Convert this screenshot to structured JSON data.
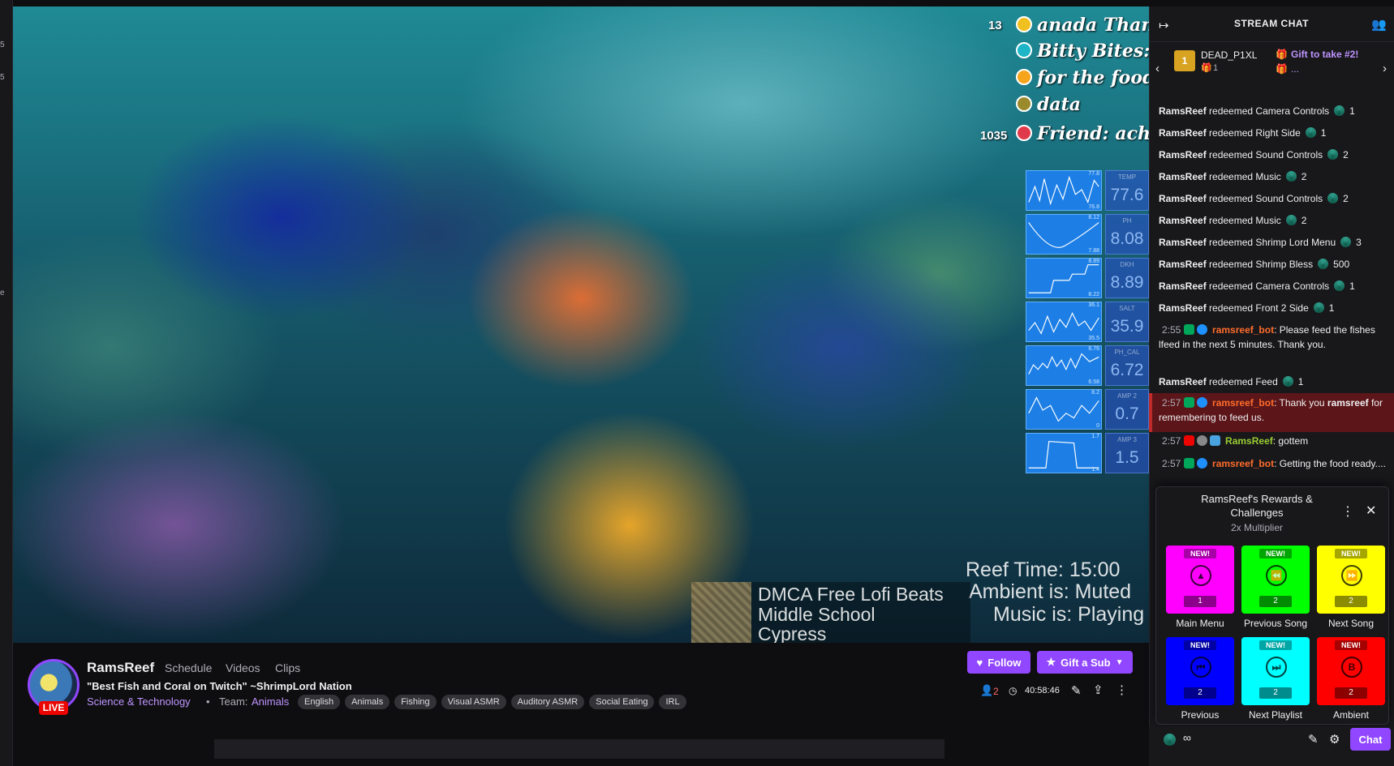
{
  "left_strip": {
    "texts": [
      "5",
      "5",
      "e"
    ]
  },
  "overlay": {
    "top_lines": [
      {
        "num": "13",
        "text": "anada Than"
      },
      {
        "num": "",
        "text": "Bitty Bites: c"
      },
      {
        "num": "",
        "text": "for the food"
      },
      {
        "num": "",
        "text": "data"
      },
      {
        "num": "1035",
        "text": "Friend: achozi"
      }
    ],
    "graphs": [
      {
        "label": "TEMP",
        "value": "77.6",
        "top_max": "77.8",
        "bottom_min": "76.8"
      },
      {
        "label": "PH",
        "value": "8.08",
        "top_max": "8.12",
        "bottom_min": "7.88"
      },
      {
        "label": "DKH",
        "value": "8.89",
        "top_max": "8.89",
        "bottom_min": "8.22"
      },
      {
        "label": "SALT",
        "value": "35.9",
        "top_max": "36.1",
        "bottom_min": "35.5"
      },
      {
        "label": "PH_CAL",
        "value": "6.72",
        "top_max": "6.76",
        "bottom_min": "6.58"
      },
      {
        "label": "AMP 2",
        "value": "0.7",
        "top_max": "8.2",
        "bottom_min": "0"
      },
      {
        "label": "AMP 3",
        "value": "1.5",
        "top_max": "1.7",
        "bottom_min": "1.4"
      }
    ],
    "reef_time": "Reef Time: 15:00",
    "ambient": "Ambient is: Muted",
    "music": "Music is: Playing",
    "song_lines": [
      "DMCA Free Lofi Beats",
      "Middle School",
      "Cypress"
    ]
  },
  "channel": {
    "name": "RamsReef",
    "nav": [
      "Schedule",
      "Videos",
      "Clips"
    ],
    "title": "\"Best Fish and Coral on Twitch\" ~ShrimpLord Nation",
    "category": "Science & Technology",
    "team_label": "Team:",
    "team": "Animals",
    "tags": [
      "English",
      "Animals",
      "Fishing",
      "Visual ASMR",
      "Auditory ASMR",
      "Social Eating",
      "IRL"
    ],
    "live": "LIVE",
    "viewers": "2",
    "uptime": "40:58:46",
    "follow": "Follow",
    "gift": "Gift a Sub"
  },
  "chat": {
    "title": "STREAM CHAT",
    "pinned_user": "DEAD_P1XL",
    "pinned_count": "1",
    "gift_text": "Gift to take #2!",
    "gift_more": "...",
    "messages": [
      {
        "user": "RamsReef",
        "text": "redeemed Camera Controls",
        "cost": "1"
      },
      {
        "user": "RamsReef",
        "text": "redeemed Right Side",
        "cost": "1"
      },
      {
        "user": "RamsReef",
        "text": "redeemed Sound Controls",
        "cost": "2"
      },
      {
        "user": "RamsReef",
        "text": "redeemed Music",
        "cost": "2"
      },
      {
        "user": "RamsReef",
        "text": "redeemed Sound Controls",
        "cost": "2"
      },
      {
        "user": "RamsReef",
        "text": "redeemed Music",
        "cost": "2"
      },
      {
        "user": "RamsReef",
        "text": "redeemed Shrimp Lord Menu",
        "cost": "3"
      },
      {
        "user": "RamsReef",
        "text": "redeemed Shrimp Bless",
        "cost": "500"
      },
      {
        "user": "RamsReef",
        "text": "redeemed Camera Controls",
        "cost": "1"
      },
      {
        "user": "RamsReef",
        "text": "redeemed Front 2 Side",
        "cost": "1"
      }
    ],
    "bot1": {
      "ts": "2:55",
      "user": "ramsreef_bot",
      "text": "Please feed the fishes lfeed in the next 5 minutes. Thank you."
    },
    "feed": {
      "user": "RamsReef",
      "text": "redeemed Feed",
      "cost": "1"
    },
    "bot2": {
      "ts": "2:57",
      "user": "ramsreef_bot",
      "text_a": "Thank you",
      "bold": "ramsreef",
      "text_b": "for remembering to feed us."
    },
    "user_msg": {
      "ts": "2:57",
      "user": "RamsReef",
      "text": "gottem"
    },
    "bot3": {
      "ts": "2:57",
      "user": "ramsreef_bot",
      "text": "Getting the food ready...."
    },
    "points": "∞",
    "chat_button": "Chat"
  },
  "rewards": {
    "title": "RamsReef's Rewards & Challenges",
    "subtitle": "2x Multiplier",
    "tiles": [
      {
        "label": "Main Menu",
        "new": "NEW!",
        "cost": "1",
        "color": "#ff00ff",
        "icon": "▲"
      },
      {
        "label": "Previous Song",
        "new": "NEW!",
        "cost": "2",
        "color": "#00ff00",
        "icon": "⏪"
      },
      {
        "label": "Next Song",
        "new": "NEW!",
        "cost": "2",
        "color": "#ffff00",
        "icon": "⏩"
      },
      {
        "label": "Previous",
        "new": "NEW!",
        "cost": "2",
        "color": "#0000ff",
        "icon": "⏮"
      },
      {
        "label": "Next Playlist",
        "new": "NEW!",
        "cost": "2",
        "color": "#00ffff",
        "icon": "⏭"
      },
      {
        "label": "Ambient",
        "new": "NEW!",
        "cost": "2",
        "color": "#ff0000",
        "icon": "B"
      }
    ]
  },
  "colors": {
    "accent": "#9147ff",
    "live": "#eb0400",
    "bot": "#ff6c2b"
  }
}
